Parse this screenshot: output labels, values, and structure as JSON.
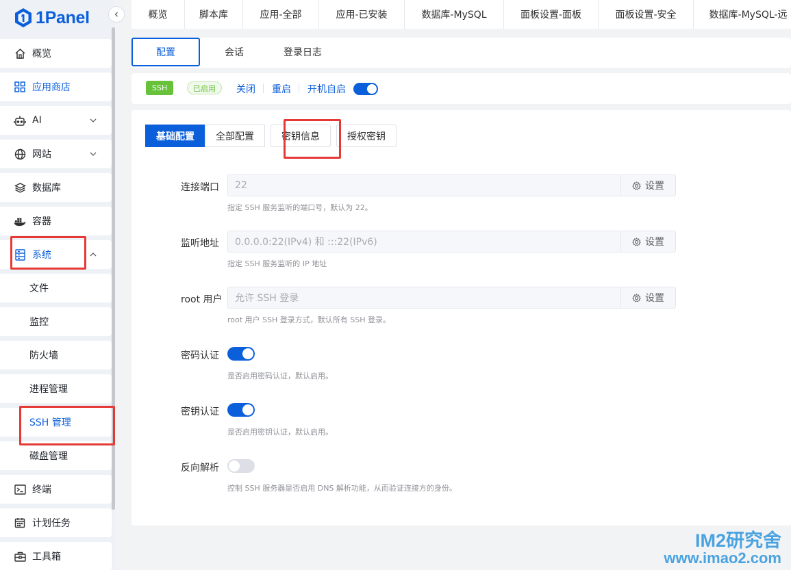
{
  "app": {
    "logo_text": "1Panel"
  },
  "sidebar": {
    "items": [
      {
        "label": "概览",
        "icon": "home-icon"
      },
      {
        "label": "应用商店",
        "icon": "apps-grid-icon"
      },
      {
        "label": "AI",
        "icon": "robot-icon"
      },
      {
        "label": "网站",
        "icon": "globe-icon"
      },
      {
        "label": "数据库",
        "icon": "layers-icon"
      },
      {
        "label": "容器",
        "icon": "docker-icon"
      },
      {
        "label": "系统",
        "icon": "server-icon"
      },
      {
        "label": "文件"
      },
      {
        "label": "监控"
      },
      {
        "label": "防火墙"
      },
      {
        "label": "进程管理"
      },
      {
        "label": "SSH 管理"
      },
      {
        "label": "磁盘管理"
      },
      {
        "label": "终端",
        "icon": "terminal-icon"
      },
      {
        "label": "计划任务",
        "icon": "calendar-icon"
      },
      {
        "label": "工具箱",
        "icon": "toolbox-icon"
      }
    ]
  },
  "top_tabs": [
    "概览",
    "脚本库",
    "应用-全部",
    "应用-已安装",
    "数据库-MySQL",
    "面板设置-面板",
    "面板设置-安全",
    "数据库-MySQL-远"
  ],
  "sub_nav": {
    "tabs": [
      "配置",
      "会话",
      "登录日志"
    ]
  },
  "status": {
    "service_tag": "SSH",
    "state_tag": "已启用",
    "actions": [
      "关闭",
      "重启"
    ],
    "autostart_label": "开机自启",
    "autostart_on": true
  },
  "config": {
    "segments": [
      "基础配置",
      "全部配置",
      "密钥信息",
      "授权密钥"
    ],
    "set_label": "设置",
    "fields": [
      {
        "label": "连接端口",
        "value": "22",
        "help": "指定 SSH 服务监听的端口号，默认为 22。"
      },
      {
        "label": "监听地址",
        "value": "0.0.0.0:22(IPv4) 和 :::22(IPv6)",
        "help": "指定 SSH 服务监听的 IP 地址"
      },
      {
        "label": "root 用户",
        "value": "允许 SSH 登录",
        "help": "root 用户 SSH 登录方式，默认所有 SSH 登录。"
      }
    ],
    "switches": [
      {
        "label": "密码认证",
        "on": true,
        "help": "是否启用密码认证，默认启用。"
      },
      {
        "label": "密钥认证",
        "on": true,
        "help": "是否启用密钥认证，默认启用。"
      },
      {
        "label": "反向解析",
        "on": false,
        "help": "控制 SSH 服务器是否启用 DNS 解析功能，从而验证连接方的身份。"
      }
    ]
  },
  "watermark": {
    "line1": "IM2研究舍",
    "line2": "www.imao2.com"
  },
  "colors": {
    "primary": "#0b5fdb",
    "success": "#67c23a",
    "annotation": "#e53935"
  }
}
